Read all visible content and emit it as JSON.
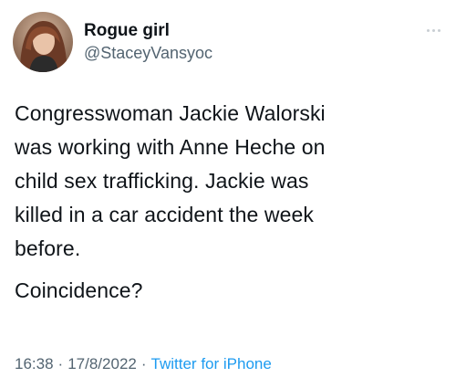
{
  "tweet": {
    "display_name": "Rogue girl",
    "handle": "@StaceyVansyoc",
    "body_lines": [
      "Congresswoman Jackie Walorski",
      "was working with Anne Heche on",
      "child sex trafficking. Jackie was",
      "killed in a car accident the week",
      "before."
    ],
    "question": "Coincidence?",
    "time": "16:38",
    "separator": "·",
    "date": "17/8/2022",
    "source": "Twitter for iPhone",
    "avatar_icon": "profile-photo",
    "more_icon": "ellipsis-icon"
  },
  "colors": {
    "text": "#0f1419",
    "secondary": "#536471",
    "link": "#1d9bf0"
  }
}
